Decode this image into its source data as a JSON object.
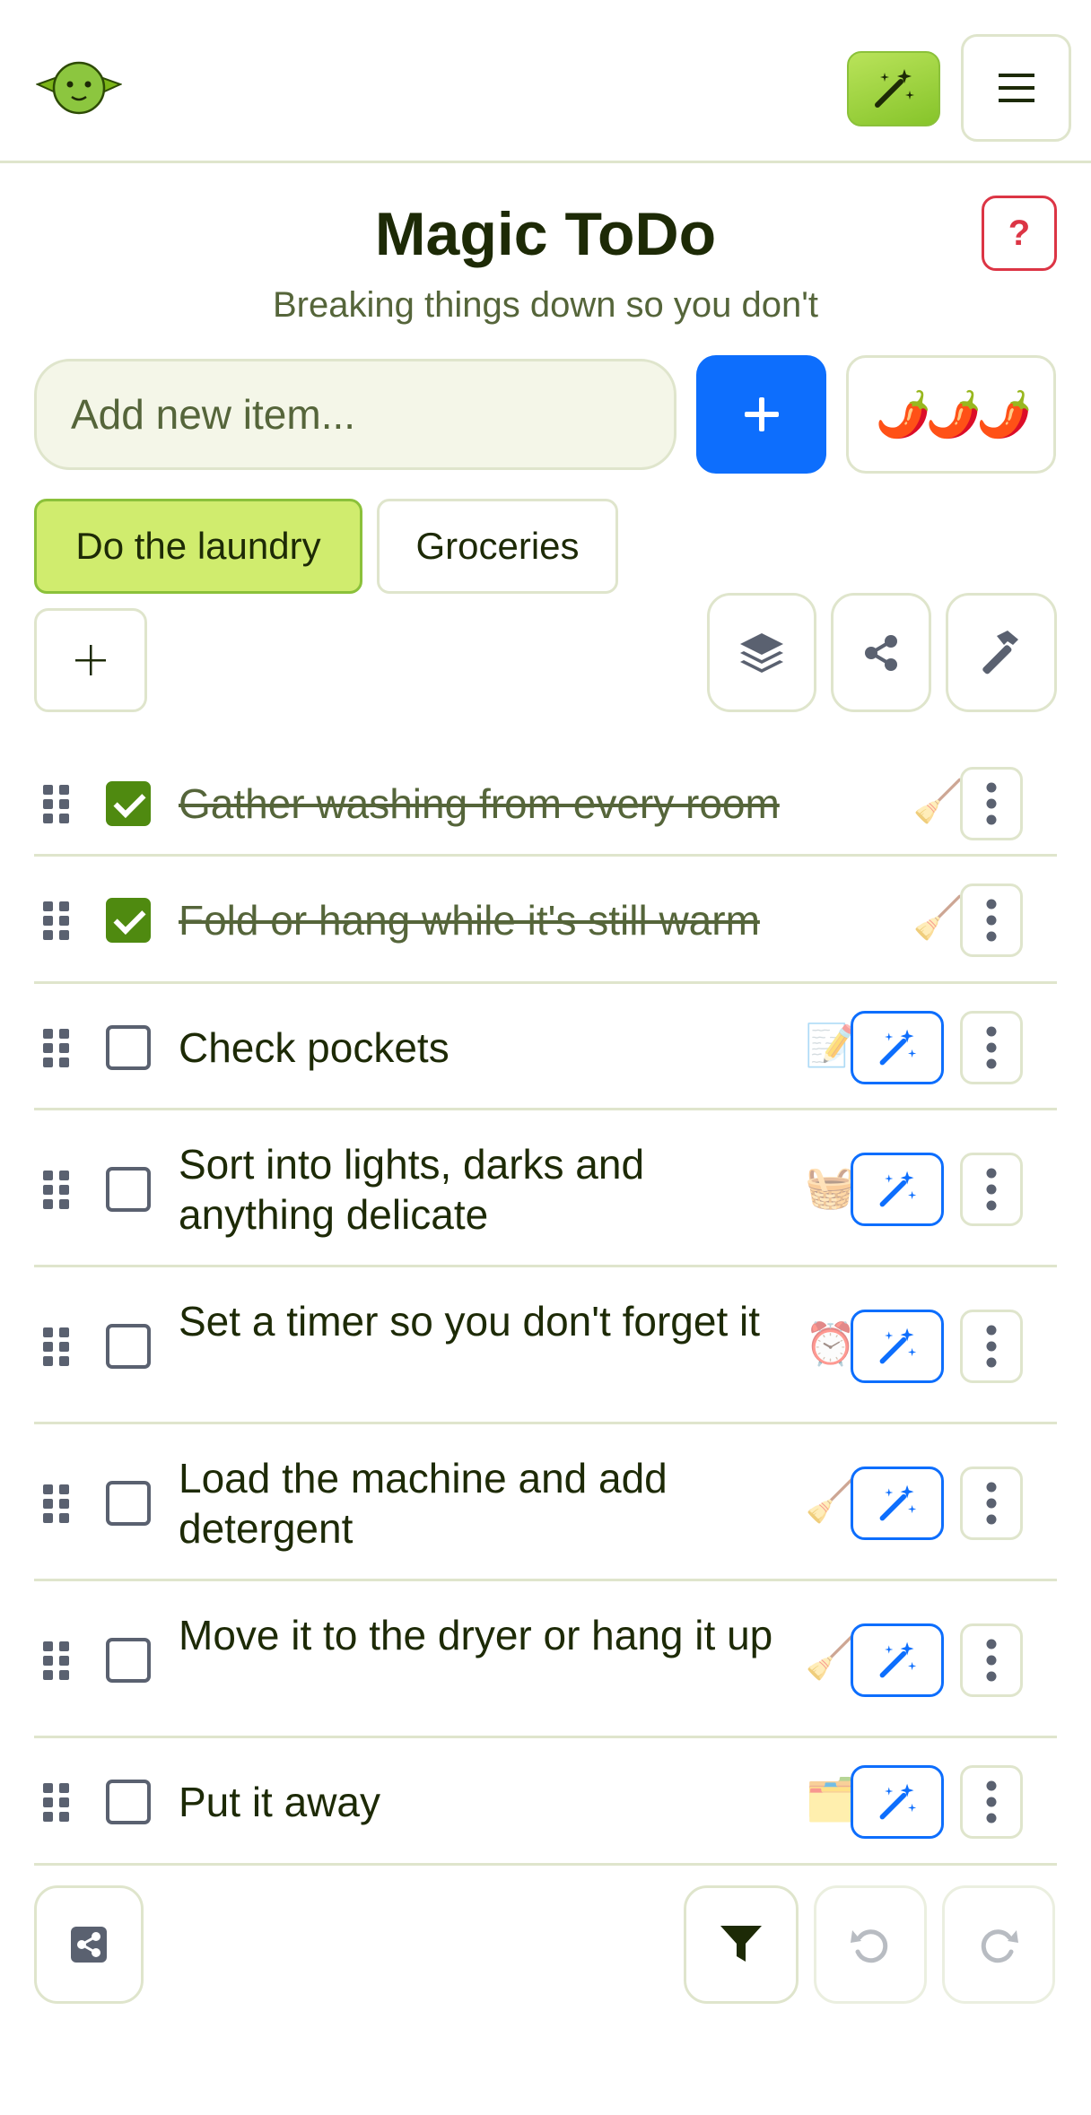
{
  "header": {
    "logo_icon": "goblin-icon",
    "magic_icon": "magic-wand-icon",
    "menu_icon": "hamburger-icon"
  },
  "app": {
    "title": "Magic ToDo",
    "subtitle": "Breaking things down so you don't",
    "help_label": "?"
  },
  "new_item": {
    "placeholder": "Add new item...",
    "add_icon": "plus-icon",
    "spiciness": "🌶️🌶️🌶️"
  },
  "lists": {
    "tabs": [
      {
        "label": "Do the laundry",
        "active": true
      },
      {
        "label": "Groceries",
        "active": false
      }
    ],
    "add_list_icon": "plus-icon",
    "actions": [
      "layers-icon",
      "share-icon",
      "hammer-icon"
    ]
  },
  "items": [
    {
      "text": "Gather washing from every room",
      "done": true,
      "emoji": "🧹"
    },
    {
      "text": "Fold or hang while it's still warm",
      "done": true,
      "emoji": "🧹"
    },
    {
      "text": "Check pockets",
      "done": false,
      "emoji": "📝"
    },
    {
      "text": "Sort into lights, darks and anything delicate",
      "done": false,
      "emoji": "🧺"
    },
    {
      "text": "Set a timer so you don't forget it",
      "done": false,
      "emoji": "⏰"
    },
    {
      "text": "Load the machine and add detergent",
      "done": false,
      "emoji": "🧹"
    },
    {
      "text": "Move it to the dryer or hang it up",
      "done": false,
      "emoji": "🧹"
    },
    {
      "text": "Put it away",
      "done": false,
      "emoji": "🗂️"
    }
  ],
  "footer": {
    "icons": [
      "share-square-icon",
      "filter-icon",
      "undo-icon",
      "redo-icon"
    ]
  },
  "colors": {
    "accent_green": "#d0ec6e",
    "primary_blue": "#0d6efd",
    "danger_red": "#dc3545",
    "border": "#dfe5cc"
  }
}
